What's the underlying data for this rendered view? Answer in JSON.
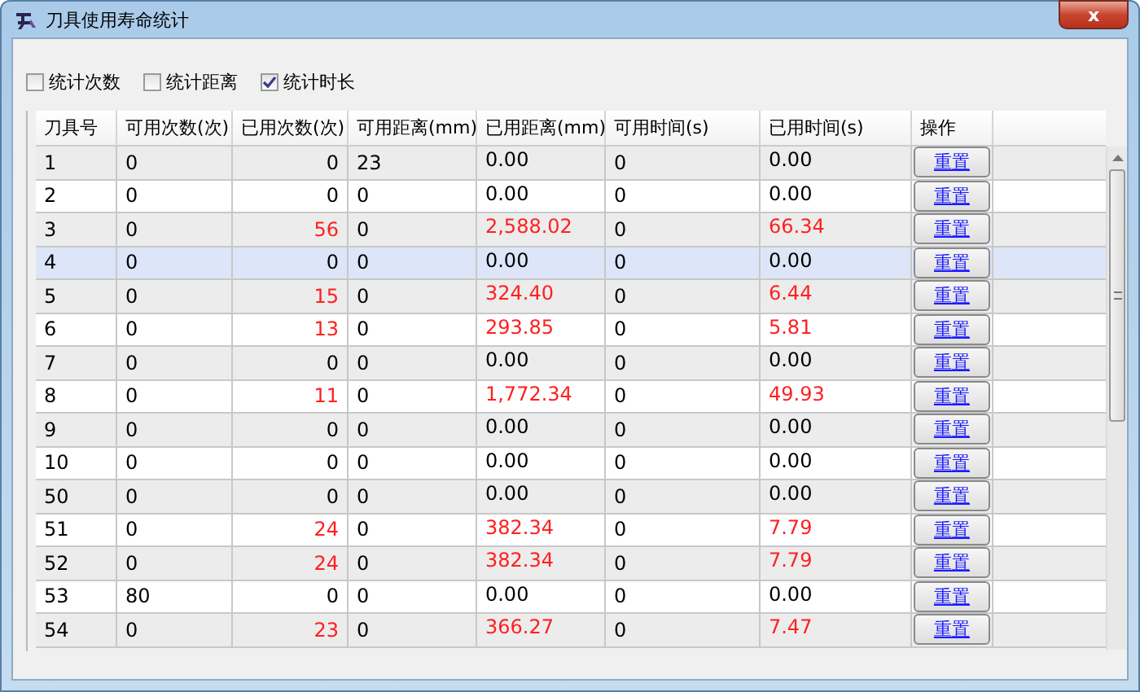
{
  "window": {
    "title": "刀具使用寿命统计",
    "close": "x"
  },
  "options": [
    {
      "label": "统计次数",
      "checked": false
    },
    {
      "label": "统计距离",
      "checked": false
    },
    {
      "label": "统计时长",
      "checked": true
    }
  ],
  "table": {
    "columns": [
      "刀具号",
      "可用次数(次)",
      "已用次数(次)",
      "可用距离(mm)",
      "已用距离(mm)",
      "可用时间(s)",
      "已用时间(s)",
      "操作"
    ],
    "rows": [
      {
        "cells": [
          "1",
          "0",
          "0",
          "23",
          "0.00",
          "0",
          "0.00"
        ],
        "used": false,
        "selected": false,
        "action": "重置"
      },
      {
        "cells": [
          "2",
          "0",
          "0",
          "0",
          "0.00",
          "0",
          "0.00"
        ],
        "used": false,
        "selected": false,
        "action": "重置"
      },
      {
        "cells": [
          "3",
          "0",
          "56",
          "0",
          "2,588.02",
          "0",
          "66.34"
        ],
        "used": true,
        "selected": false,
        "action": "重置"
      },
      {
        "cells": [
          "4",
          "0",
          "0",
          "0",
          "0.00",
          "0",
          "0.00"
        ],
        "used": false,
        "selected": true,
        "action": "重置"
      },
      {
        "cells": [
          "5",
          "0",
          "15",
          "0",
          "324.40",
          "0",
          "6.44"
        ],
        "used": true,
        "selected": false,
        "action": "重置"
      },
      {
        "cells": [
          "6",
          "0",
          "13",
          "0",
          "293.85",
          "0",
          "5.81"
        ],
        "used": true,
        "selected": false,
        "action": "重置"
      },
      {
        "cells": [
          "7",
          "0",
          "0",
          "0",
          "0.00",
          "0",
          "0.00"
        ],
        "used": false,
        "selected": false,
        "action": "重置"
      },
      {
        "cells": [
          "8",
          "0",
          "11",
          "0",
          "1,772.34",
          "0",
          "49.93"
        ],
        "used": true,
        "selected": false,
        "action": "重置"
      },
      {
        "cells": [
          "9",
          "0",
          "0",
          "0",
          "0.00",
          "0",
          "0.00"
        ],
        "used": false,
        "selected": false,
        "action": "重置"
      },
      {
        "cells": [
          "10",
          "0",
          "0",
          "0",
          "0.00",
          "0",
          "0.00"
        ],
        "used": false,
        "selected": false,
        "action": "重置"
      },
      {
        "cells": [
          "50",
          "0",
          "0",
          "0",
          "0.00",
          "0",
          "0.00"
        ],
        "used": false,
        "selected": false,
        "action": "重置"
      },
      {
        "cells": [
          "51",
          "0",
          "24",
          "0",
          "382.34",
          "0",
          "7.79"
        ],
        "used": true,
        "selected": false,
        "action": "重置"
      },
      {
        "cells": [
          "52",
          "0",
          "24",
          "0",
          "382.34",
          "0",
          "7.79"
        ],
        "used": true,
        "selected": false,
        "action": "重置"
      },
      {
        "cells": [
          "53",
          "80",
          "0",
          "0",
          "0.00",
          "0",
          "0.00"
        ],
        "used": false,
        "selected": false,
        "action": "重置"
      },
      {
        "cells": [
          "54",
          "0",
          "23",
          "0",
          "366.27",
          "0",
          "7.47"
        ],
        "used": true,
        "selected": false,
        "action": "重置"
      }
    ]
  }
}
